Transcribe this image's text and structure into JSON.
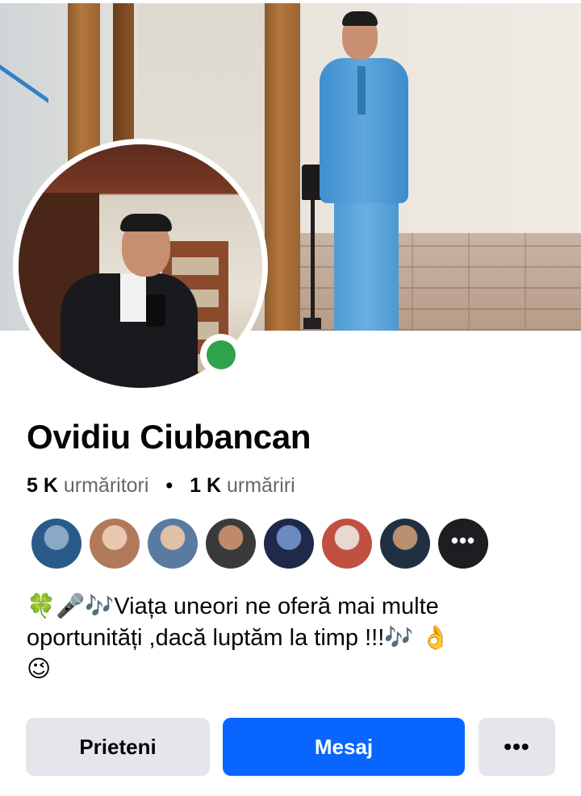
{
  "profile": {
    "name": "Ovidiu Ciubancan",
    "followers_count": "5 K",
    "followers_label": "urmăritori",
    "separator": "•",
    "following_count": "1 K",
    "following_label": "urmăriri",
    "online": true,
    "bio_emoji_start": "🍀🎤🎶",
    "bio_text": "Viața uneori ne oferă mai multe oportunități ,dacă luptăm la timp !!!",
    "bio_emoji_end": "🎶 👌",
    "bio_emoji_last": "😉"
  },
  "friends_preview": {
    "avatars": [
      {
        "colors": [
          "#2a5a8a",
          "#8aa8c8"
        ]
      },
      {
        "colors": [
          "#b07a5a",
          "#e8c9b0"
        ]
      },
      {
        "colors": [
          "#5a7aa0",
          "#e0c0a8"
        ]
      },
      {
        "colors": [
          "#3a3a3a",
          "#c08a6a"
        ]
      },
      {
        "colors": [
          "#1f2a4a",
          "#6a8ac0"
        ]
      },
      {
        "colors": [
          "#c05040",
          "#e8d8d0"
        ]
      },
      {
        "colors": [
          "#203040",
          "#b89070"
        ]
      }
    ],
    "more_label": "•••"
  },
  "actions": {
    "friends_label": "Prieteni",
    "message_label": "Mesaj",
    "more_label": "•••"
  },
  "colors": {
    "primary": "#0866ff",
    "secondary_button": "#e4e6eb",
    "online": "#31a24c",
    "muted_text": "#65676b"
  }
}
